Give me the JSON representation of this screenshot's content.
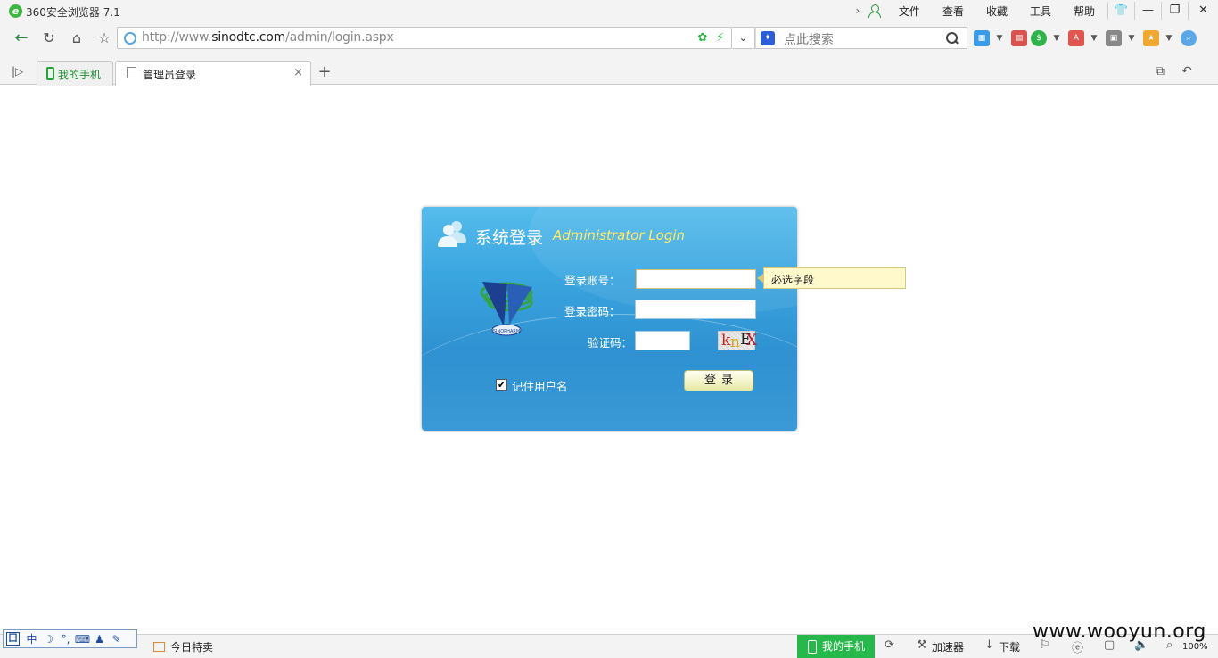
{
  "browser": {
    "title": "360安全浏览器 7.1",
    "menu": [
      "文件",
      "查看",
      "收藏",
      "工具",
      "帮助"
    ],
    "window_buttons": {
      "skin": "👕",
      "minimize": "—",
      "restore": "❐",
      "close": "✕"
    }
  },
  "address_bar": {
    "url_prefix": "http://www.",
    "url_host": "sinodtc.com",
    "url_path": "/admin/login.aspx",
    "search_placeholder": "点此搜索"
  },
  "tabs": [
    {
      "label": "我的手机",
      "active": false
    },
    {
      "label": "管理员登录",
      "active": true
    }
  ],
  "login": {
    "title": "系统登录",
    "subtitle": "Administrator Login",
    "username_label": "登录账号：",
    "password_label": "登录密码：",
    "captcha_label": "验证码：",
    "username_value": "",
    "password_value": "",
    "captcha_value": "",
    "captcha_chars": [
      "k",
      "n",
      "E",
      "X"
    ],
    "logo_text": "SINOPHARM",
    "remember_label": "记住用户名",
    "remember_checked": true,
    "remember_mark": "✔",
    "submit_label": "登录"
  },
  "tooltip": {
    "text": "必选字段"
  },
  "statusbar": {
    "ime": [
      "囗",
      "中",
      "☽",
      "°,",
      "⌨",
      "♟",
      "✎"
    ],
    "deal_label": "今日特卖",
    "phone_label": "我的手机",
    "accelerator_label": "加速器",
    "download_label": "下载",
    "zoom": "100%"
  },
  "watermark": "www.wooyun.org",
  "colors": {
    "panel_blue": "#3aa6e0",
    "subtitle_yellow": "#ffe96a",
    "tooltip_bg": "#fff9cc",
    "phone_green": "#27b84b"
  }
}
